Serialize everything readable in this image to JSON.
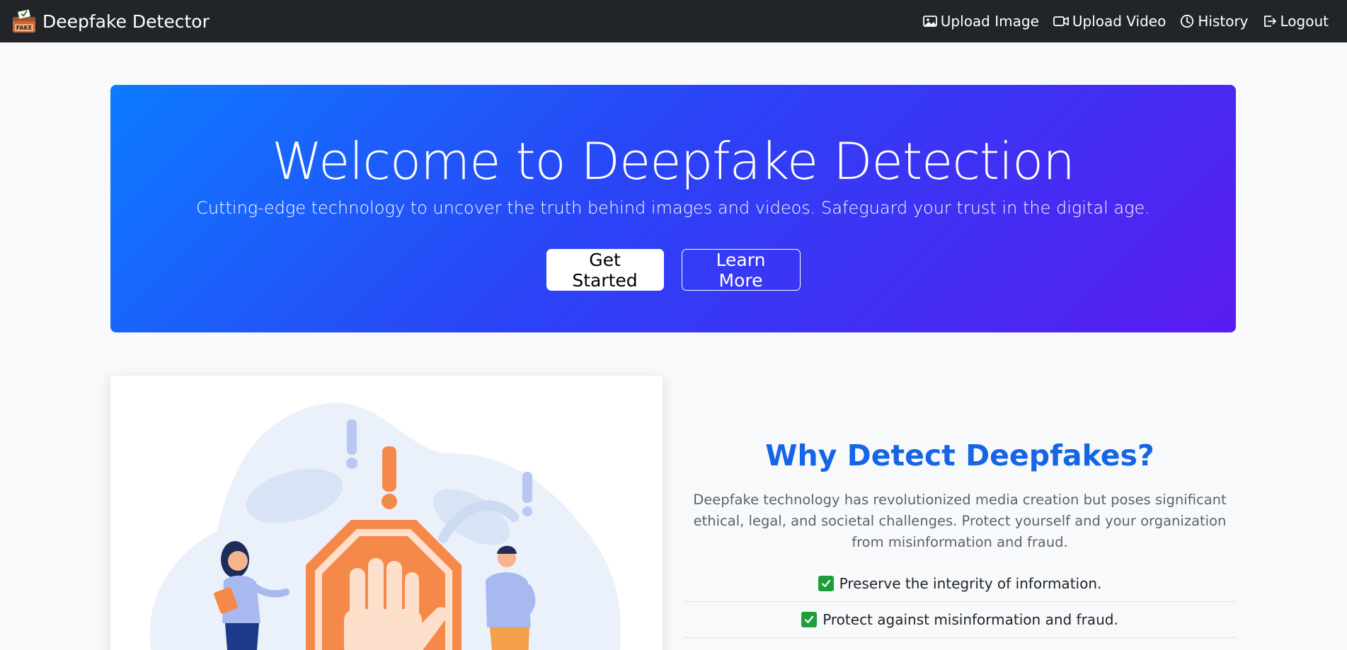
{
  "navbar": {
    "brand": "Deepfake Detector",
    "logo_text": "FAKE",
    "links": [
      {
        "label": "Upload Image",
        "icon": "image-icon"
      },
      {
        "label": "Upload Video",
        "icon": "video-icon"
      },
      {
        "label": "History",
        "icon": "clock-icon"
      },
      {
        "label": "Logout",
        "icon": "logout-icon"
      }
    ]
  },
  "hero": {
    "title": "Welcome to Deepfake Detection",
    "subtitle": "Cutting-edge technology to uncover the truth behind images and videos. Safeguard your trust in the digital age.",
    "primary_button": "Get Started",
    "secondary_button": "Learn More",
    "gradient_start": "#0d7bff",
    "gradient_end": "#5a1bf0"
  },
  "why": {
    "title": "Why Detect Deepfakes?",
    "text": "Deepfake technology has revolutionized media creation but poses significant ethical, legal, and societal challenges. Protect yourself and your organization from misinformation and fraud.",
    "points": [
      "Preserve the integrity of information.",
      "Protect against misinformation and fraud."
    ],
    "accent": "#1565e6"
  }
}
